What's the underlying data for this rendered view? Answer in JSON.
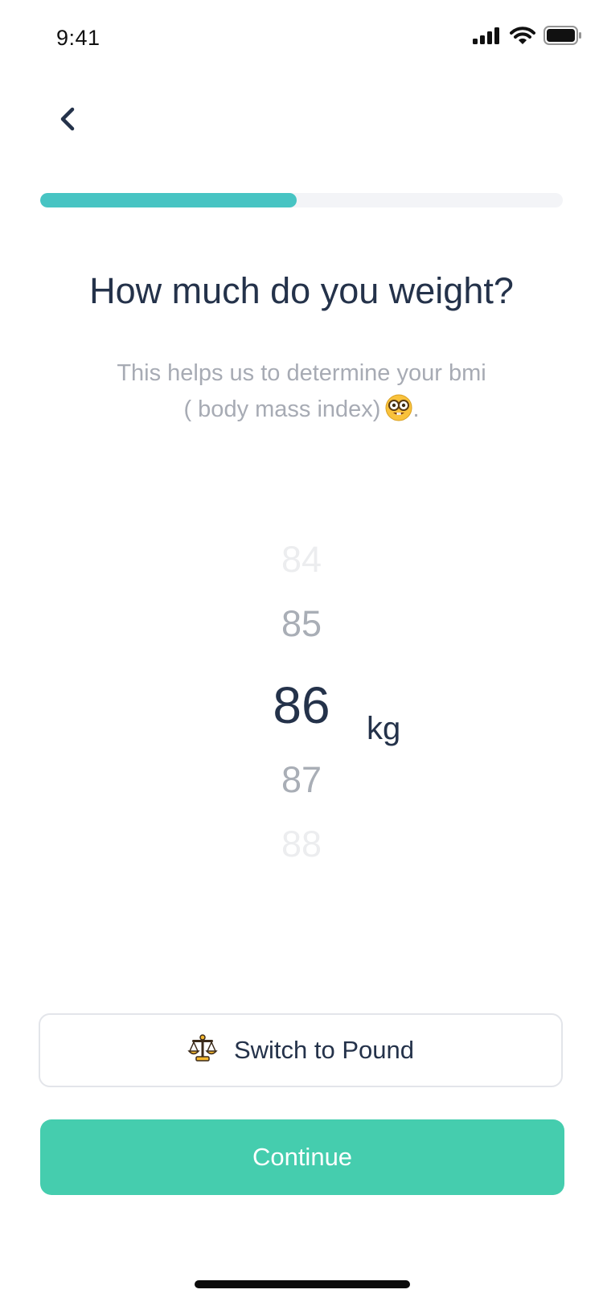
{
  "status_bar": {
    "time": "9:41",
    "icons": [
      "cellular-signal-icon",
      "wifi-icon",
      "battery-icon"
    ]
  },
  "nav": {
    "back_icon": "chevron-left-icon"
  },
  "progress": {
    "value_percent": 49,
    "fill_color": "#47C4C3",
    "track_color": "#F3F4F7"
  },
  "title": "How much do you weight?",
  "subtitle": {
    "line1": "This helps us to determine your bmi",
    "line2": "( body mass index)",
    "line2_suffix": ".",
    "emoji_icon": "nerd-face-emoji-icon"
  },
  "weight_picker": {
    "values": [
      "84",
      "85",
      "86",
      "87",
      "88"
    ],
    "selected": "86",
    "unit": "kg"
  },
  "switch_button": {
    "icon": "balance-scale-icon",
    "label": "Switch to Pound"
  },
  "continue_button": {
    "label": "Continue",
    "color": "#45CDAE"
  }
}
